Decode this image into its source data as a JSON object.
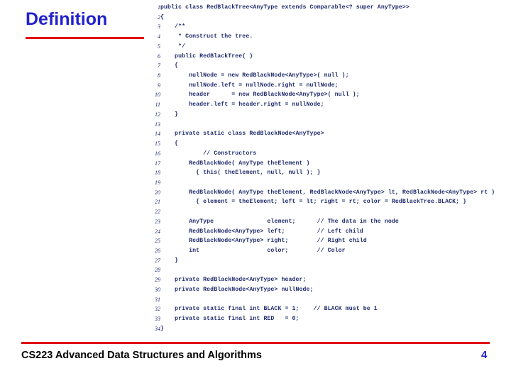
{
  "slide": {
    "title": "Definition",
    "accent_red": "#e00000",
    "title_blue": "#2222cc",
    "code_color": "#1f2b6c"
  },
  "code": {
    "lines": [
      {
        "n": "1",
        "text": "public class RedBlackTree<AnyType extends Comparable<? super AnyType>>"
      },
      {
        "n": "2",
        "text": "{"
      },
      {
        "n": "3",
        "text": "    /**"
      },
      {
        "n": "4",
        "text": "     * Construct the tree."
      },
      {
        "n": "5",
        "text": "     */"
      },
      {
        "n": "6",
        "text": "    public RedBlackTree( )"
      },
      {
        "n": "7",
        "text": "    {"
      },
      {
        "n": "8",
        "text": "        nullNode = new RedBlackNode<AnyType>( null );"
      },
      {
        "n": "9",
        "text": "        nullNode.left = nullNode.right = nullNode;"
      },
      {
        "n": "10",
        "text": "        header      = new RedBlackNode<AnyType>( null );"
      },
      {
        "n": "11",
        "text": "        header.left = header.right = nullNode;"
      },
      {
        "n": "12",
        "text": "    }"
      },
      {
        "n": "13",
        "text": ""
      },
      {
        "n": "14",
        "text": "    private static class RedBlackNode<AnyType>"
      },
      {
        "n": "15",
        "text": "    {"
      },
      {
        "n": "16",
        "text": "            // Constructors"
      },
      {
        "n": "17",
        "text": "        RedBlackNode( AnyType theElement )"
      },
      {
        "n": "18",
        "text": "          { this( theElement, null, null ); }"
      },
      {
        "n": "19",
        "text": ""
      },
      {
        "n": "20",
        "text": "        RedBlackNode( AnyType theElement, RedBlackNode<AnyType> lt, RedBlackNode<AnyType> rt )"
      },
      {
        "n": "21",
        "text": "          { element = theElement; left = lt; right = rt; color = RedBlackTree.BLACK; }"
      },
      {
        "n": "22",
        "text": ""
      },
      {
        "n": "23",
        "text": "        AnyType               element;      // The data in the node"
      },
      {
        "n": "24",
        "text": "        RedBlackNode<AnyType> left;         // Left child"
      },
      {
        "n": "25",
        "text": "        RedBlackNode<AnyType> right;        // Right child"
      },
      {
        "n": "26",
        "text": "        int                   color;        // Color"
      },
      {
        "n": "27",
        "text": "    }"
      },
      {
        "n": "28",
        "text": ""
      },
      {
        "n": "29",
        "text": "    private RedBlackNode<AnyType> header;"
      },
      {
        "n": "30",
        "text": "    private RedBlackNode<AnyType> nullNode;"
      },
      {
        "n": "31",
        "text": ""
      },
      {
        "n": "32",
        "text": "    private static final int BLACK = 1;    // BLACK must be 1"
      },
      {
        "n": "33",
        "text": "    private static final int RED   = 0;"
      },
      {
        "n": "34",
        "text": "}"
      }
    ]
  },
  "footer": {
    "text": "CS223 Advanced Data Structures and Algorithms",
    "page_number": "4"
  }
}
